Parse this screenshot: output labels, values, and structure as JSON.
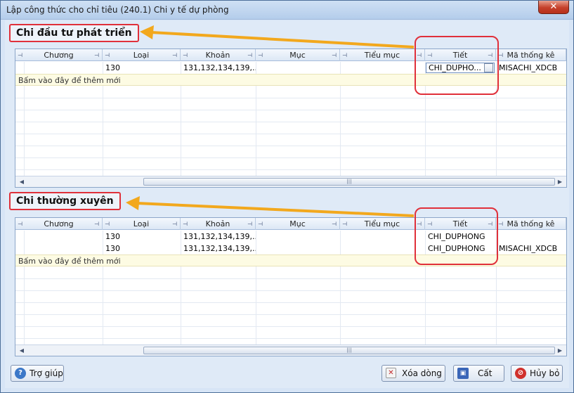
{
  "window": {
    "title": "Lập công thức cho chỉ tiêu (240.1) Chi y tế dự phòng",
    "close_glyph": "✕"
  },
  "columns": [
    "Chương",
    "Loại",
    "Khoản",
    "Mục",
    "Tiểu mục",
    "Tiết",
    "Mã thống kê"
  ],
  "section1": {
    "label": "Chi đầu tư phát triển",
    "rows": [
      {
        "chuong": "",
        "loai": "130",
        "khoan": "131,132,134,139,...",
        "muc": "",
        "tieu_muc": "",
        "tiet": "CHI_DUPHO...",
        "ma_thong_ke": "MISACHI_XDCB"
      }
    ],
    "add_row_text": "Bấm vào đây để thêm mới"
  },
  "section2": {
    "label": "Chi thường xuyên",
    "rows": [
      {
        "chuong": "",
        "loai": "130",
        "khoan": "131,132,134,139,...",
        "muc": "",
        "tieu_muc": "",
        "tiet": "CHI_DUPHONG",
        "ma_thong_ke": ""
      },
      {
        "chuong": "",
        "loai": "130",
        "khoan": "131,132,134,139,...",
        "muc": "",
        "tieu_muc": "",
        "tiet": "CHI_DUPHONG",
        "ma_thong_ke": "MISACHI_XDCB"
      }
    ],
    "add_row_text": "Bấm vào đây để thêm mới"
  },
  "buttons": {
    "help": "Trợ giúp",
    "delete": "Xóa dòng",
    "save": "Cất",
    "cancel": "Hủy bỏ"
  },
  "icons": {
    "help": "help-icon",
    "delete": "delete-row-icon",
    "save": "save-icon",
    "cancel": "cancel-icon",
    "pin": "pin-icon"
  },
  "colors": {
    "annotation_red": "#e0303a",
    "annotation_arrow": "#f2a81d",
    "window_bg": "#dfeaf7"
  }
}
